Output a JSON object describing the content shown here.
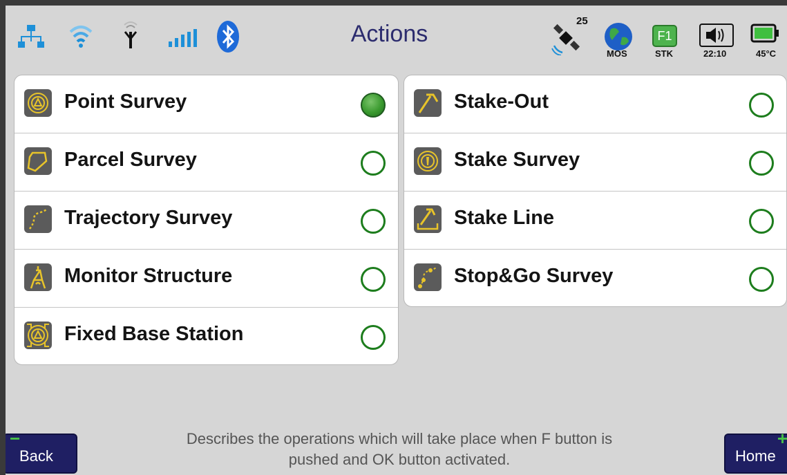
{
  "title": "Actions",
  "status": {
    "satellites": "25",
    "network_label": "MOS",
    "mode_badge": "F1",
    "mode_label": "STK",
    "time": "22:10",
    "temperature": "45°C",
    "icons": [
      "ethernet-icon",
      "wifi-icon",
      "antenna-icon",
      "signal-bars-icon",
      "bluetooth-icon",
      "satellite-icon",
      "globe-icon",
      "mode-badge-icon",
      "speaker-icon",
      "battery-icon"
    ],
    "accent_color": "#1f1f63",
    "signal_color": "#1e90d8"
  },
  "left_actions": [
    {
      "label": "Point Survey",
      "icon": "point-survey-icon",
      "selected": true
    },
    {
      "label": "Parcel Survey",
      "icon": "parcel-survey-icon",
      "selected": false
    },
    {
      "label": "Trajectory Survey",
      "icon": "trajectory-survey-icon",
      "selected": false
    },
    {
      "label": "Monitor Structure",
      "icon": "monitor-structure-icon",
      "selected": false
    },
    {
      "label": "Fixed Base Station",
      "icon": "fixed-base-station-icon",
      "selected": false
    }
  ],
  "right_actions": [
    {
      "label": "Stake-Out",
      "icon": "stake-out-icon",
      "selected": false
    },
    {
      "label": "Stake Survey",
      "icon": "stake-survey-icon",
      "selected": false
    },
    {
      "label": "Stake Line",
      "icon": "stake-line-icon",
      "selected": false
    },
    {
      "label": "Stop&Go Survey",
      "icon": "stop-go-survey-icon",
      "selected": false
    }
  ],
  "footer": {
    "back_label": "Back",
    "home_label": "Home",
    "description": "Describes the operations which will take place when F button is pushed and OK button activated."
  }
}
